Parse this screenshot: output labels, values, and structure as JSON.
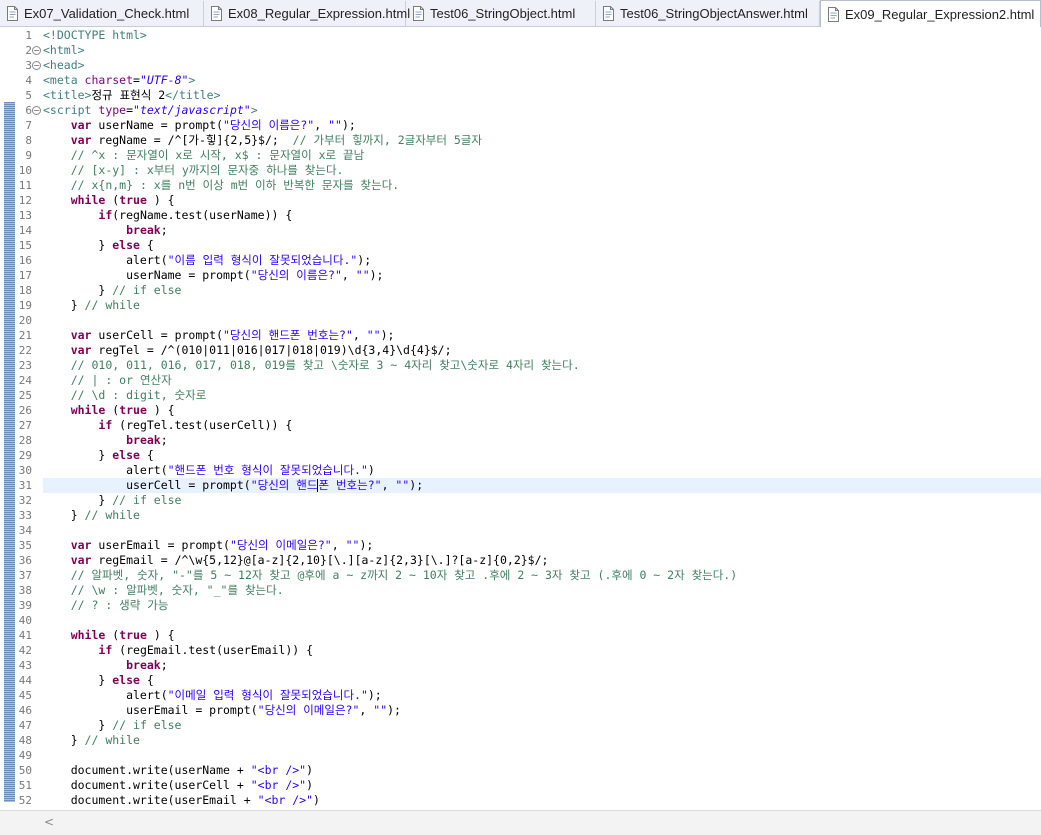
{
  "tabs": [
    {
      "label": "Ex07_Validation_Check.html",
      "active": false
    },
    {
      "label": "Ex08_Regular_Expression.html",
      "active": false
    },
    {
      "label": "Test06_StringObject.html",
      "active": false
    },
    {
      "label": "Test06_StringObjectAnswer.html",
      "active": false
    },
    {
      "label": "Ex09_Regular_Expression2.html",
      "active": true
    }
  ],
  "close_glyph": "✕",
  "current_line": 31,
  "colors": {
    "keyword": "#7f0055",
    "string": "#2a00ff",
    "comment": "#3f7f5f",
    "tag": "#3f7f7f",
    "attribute": "#7f007f",
    "current_line_bg": "#e8f2fe"
  },
  "code_lines": [
    {
      "n": "1",
      "fold": "",
      "segs": [
        [
          "tag",
          "<!DOCTYPE html>"
        ]
      ]
    },
    {
      "n": "2",
      "fold": "⊖",
      "segs": [
        [
          "tag",
          "<html>"
        ]
      ]
    },
    {
      "n": "3",
      "fold": "⊖",
      "segs": [
        [
          "tag",
          "<head>"
        ]
      ]
    },
    {
      "n": "4",
      "fold": "",
      "segs": [
        [
          "tag",
          "<meta "
        ],
        [
          "attr",
          "charset"
        ],
        [
          "",
          "="
        ],
        [
          "aval",
          "\"UTF-8\""
        ],
        [
          "tag",
          ">"
        ]
      ]
    },
    {
      "n": "5",
      "fold": "",
      "segs": [
        [
          "tag",
          "<title>"
        ],
        [
          "",
          "정규 표현식 2"
        ],
        [
          "tag",
          "</title>"
        ]
      ]
    },
    {
      "n": "6",
      "fold": "⊖",
      "segs": [
        [
          "tag",
          "<script "
        ],
        [
          "attr",
          "type"
        ],
        [
          "",
          "="
        ],
        [
          "aval",
          "\"text/javascript\""
        ],
        [
          "tag",
          ">"
        ]
      ]
    },
    {
      "n": "7",
      "fold": "",
      "segs": [
        [
          "",
          "    "
        ],
        [
          "kw",
          "var"
        ],
        [
          "",
          " userName = prompt("
        ],
        [
          "str",
          "\"당신의 이름은?\""
        ],
        [
          "",
          ", "
        ],
        [
          "str",
          "\"\""
        ],
        [
          "",
          ");"
        ]
      ]
    },
    {
      "n": "8",
      "fold": "",
      "segs": [
        [
          "",
          "    "
        ],
        [
          "kw",
          "var"
        ],
        [
          "",
          " regName = /^[가-힣]{2,5}$/;  "
        ],
        [
          "cmt",
          "// 가부터 힣까지, 2글자부터 5글자"
        ]
      ]
    },
    {
      "n": "9",
      "fold": "",
      "segs": [
        [
          "",
          "    "
        ],
        [
          "cmt",
          "// ^x : 문자열이 x로 시작, x$ : 문자열이 x로 끝남"
        ]
      ]
    },
    {
      "n": "10",
      "fold": "",
      "segs": [
        [
          "",
          "    "
        ],
        [
          "cmt",
          "// [x-y] : x부터 y까지의 문자중 하나를 찾는다."
        ]
      ]
    },
    {
      "n": "11",
      "fold": "",
      "segs": [
        [
          "",
          "    "
        ],
        [
          "cmt",
          "// x{n,m} : x를 n번 이상 m번 이하 반복한 문자를 찾는다."
        ]
      ]
    },
    {
      "n": "12",
      "fold": "",
      "segs": [
        [
          "",
          "    "
        ],
        [
          "kw",
          "while"
        ],
        [
          "",
          " ("
        ],
        [
          "kw",
          "true"
        ],
        [
          "",
          " ) {"
        ]
      ]
    },
    {
      "n": "13",
      "fold": "",
      "segs": [
        [
          "",
          "        "
        ],
        [
          "kw",
          "if"
        ],
        [
          "",
          "(regName.test(userName)) {"
        ]
      ]
    },
    {
      "n": "14",
      "fold": "",
      "segs": [
        [
          "",
          "            "
        ],
        [
          "kw",
          "break"
        ],
        [
          "",
          ";"
        ]
      ]
    },
    {
      "n": "15",
      "fold": "",
      "segs": [
        [
          "",
          "        } "
        ],
        [
          "kw",
          "else"
        ],
        [
          "",
          " {"
        ]
      ]
    },
    {
      "n": "16",
      "fold": "",
      "segs": [
        [
          "",
          "            alert("
        ],
        [
          "str",
          "\"이름 입력 형식이 잘못되었습니다.\""
        ],
        [
          "",
          ");"
        ]
      ]
    },
    {
      "n": "17",
      "fold": "",
      "segs": [
        [
          "",
          "            userName = prompt("
        ],
        [
          "str",
          "\"당신의 이름은?\""
        ],
        [
          "",
          ", "
        ],
        [
          "str",
          "\"\""
        ],
        [
          "",
          ");"
        ]
      ]
    },
    {
      "n": "18",
      "fold": "",
      "segs": [
        [
          "",
          "        } "
        ],
        [
          "cmt",
          "// if else"
        ]
      ]
    },
    {
      "n": "19",
      "fold": "",
      "segs": [
        [
          "",
          "    } "
        ],
        [
          "cmt",
          "// while"
        ]
      ]
    },
    {
      "n": "20",
      "fold": "",
      "segs": []
    },
    {
      "n": "21",
      "fold": "",
      "segs": [
        [
          "",
          "    "
        ],
        [
          "kw",
          "var"
        ],
        [
          "",
          " userCell = prompt("
        ],
        [
          "str",
          "\"당신의 핸드폰 번호는?\""
        ],
        [
          "",
          ", "
        ],
        [
          "str",
          "\"\""
        ],
        [
          "",
          ");"
        ]
      ]
    },
    {
      "n": "22",
      "fold": "",
      "segs": [
        [
          "",
          "    "
        ],
        [
          "kw",
          "var"
        ],
        [
          "",
          " regTel = /^(010|011|016|017|018|019)\\d{3,4}\\d{4}$/;"
        ]
      ]
    },
    {
      "n": "23",
      "fold": "",
      "segs": [
        [
          "",
          "    "
        ],
        [
          "cmt",
          "// 010, 011, 016, 017, 018, 019를 찾고 \\숫자로 3 ~ 4자리 찾고\\숫자로 4자리 찾는다."
        ]
      ]
    },
    {
      "n": "24",
      "fold": "",
      "segs": [
        [
          "",
          "    "
        ],
        [
          "cmt",
          "// | : or 연산자"
        ]
      ]
    },
    {
      "n": "25",
      "fold": "",
      "segs": [
        [
          "",
          "    "
        ],
        [
          "cmt",
          "// \\d : digit, 숫자로"
        ]
      ]
    },
    {
      "n": "26",
      "fold": "",
      "segs": [
        [
          "",
          "    "
        ],
        [
          "kw",
          "while"
        ],
        [
          "",
          " ("
        ],
        [
          "kw",
          "true"
        ],
        [
          "",
          " ) {"
        ]
      ]
    },
    {
      "n": "27",
      "fold": "",
      "segs": [
        [
          "",
          "        "
        ],
        [
          "kw",
          "if"
        ],
        [
          "",
          " (regTel.test(userCell)) {"
        ]
      ]
    },
    {
      "n": "28",
      "fold": "",
      "segs": [
        [
          "",
          "            "
        ],
        [
          "kw",
          "break"
        ],
        [
          "",
          ";"
        ]
      ]
    },
    {
      "n": "29",
      "fold": "",
      "segs": [
        [
          "",
          "        } "
        ],
        [
          "kw",
          "else"
        ],
        [
          "",
          " {"
        ]
      ]
    },
    {
      "n": "30",
      "fold": "",
      "segs": [
        [
          "",
          "            alert("
        ],
        [
          "str",
          "\"핸드폰 번호 형식이 잘못되었습니다.\""
        ],
        [
          "",
          ")"
        ]
      ]
    },
    {
      "n": "31",
      "fold": "",
      "segs": [
        [
          "",
          "            userCell = prompt("
        ],
        [
          "str",
          "\"당신의 핸드"
        ],
        [
          "caret",
          ""
        ],
        [
          "str",
          "폰 번호는?\""
        ],
        [
          "",
          ", "
        ],
        [
          "str",
          "\"\""
        ],
        [
          "",
          ");"
        ]
      ]
    },
    {
      "n": "32",
      "fold": "",
      "segs": [
        [
          "",
          "        } "
        ],
        [
          "cmt",
          "// if else"
        ]
      ]
    },
    {
      "n": "33",
      "fold": "",
      "segs": [
        [
          "",
          "    } "
        ],
        [
          "cmt",
          "// while"
        ]
      ]
    },
    {
      "n": "34",
      "fold": "",
      "segs": []
    },
    {
      "n": "35",
      "fold": "",
      "segs": [
        [
          "",
          "    "
        ],
        [
          "kw",
          "var"
        ],
        [
          "",
          " userEmail = prompt("
        ],
        [
          "str",
          "\"당신의 이메일은?\""
        ],
        [
          "",
          ", "
        ],
        [
          "str",
          "\"\""
        ],
        [
          "",
          ");"
        ]
      ]
    },
    {
      "n": "36",
      "fold": "",
      "segs": [
        [
          "",
          "    "
        ],
        [
          "kw",
          "var"
        ],
        [
          "",
          " regEmail = /^\\w{5,12}@[a-z]{2,10}[\\.][a-z]{2,3}[\\.]?[a-z]{0,2}$/;"
        ]
      ]
    },
    {
      "n": "37",
      "fold": "",
      "segs": [
        [
          "",
          "    "
        ],
        [
          "cmt",
          "// 알파벳, 숫자, \"-\"를 5 ~ 12자 찾고 @후에 a ~ z까지 2 ~ 10자 찾고 .후에 2 ~ 3자 찾고 (.후에 0 ~ 2자 찾는다.)"
        ]
      ]
    },
    {
      "n": "38",
      "fold": "",
      "segs": [
        [
          "",
          "    "
        ],
        [
          "cmt",
          "// \\w : 알파벳, 숫자, \"_\"를 찾는다."
        ]
      ]
    },
    {
      "n": "39",
      "fold": "",
      "segs": [
        [
          "",
          "    "
        ],
        [
          "cmt",
          "// ? : 생략 가능"
        ]
      ]
    },
    {
      "n": "40",
      "fold": "",
      "segs": []
    },
    {
      "n": "41",
      "fold": "",
      "segs": [
        [
          "",
          "    "
        ],
        [
          "kw",
          "while"
        ],
        [
          "",
          " ("
        ],
        [
          "kw",
          "true"
        ],
        [
          "",
          " ) {"
        ]
      ]
    },
    {
      "n": "42",
      "fold": "",
      "segs": [
        [
          "",
          "        "
        ],
        [
          "kw",
          "if"
        ],
        [
          "",
          " (regEmail.test(userEmail)) {"
        ]
      ]
    },
    {
      "n": "43",
      "fold": "",
      "segs": [
        [
          "",
          "            "
        ],
        [
          "kw",
          "break"
        ],
        [
          "",
          ";"
        ]
      ]
    },
    {
      "n": "44",
      "fold": "",
      "segs": [
        [
          "",
          "        } "
        ],
        [
          "kw",
          "else"
        ],
        [
          "",
          " {"
        ]
      ]
    },
    {
      "n": "45",
      "fold": "",
      "segs": [
        [
          "",
          "            alert("
        ],
        [
          "str",
          "\"이메일 입력 형식이 잘못되었습니다.\""
        ],
        [
          "",
          ");"
        ]
      ]
    },
    {
      "n": "46",
      "fold": "",
      "segs": [
        [
          "",
          "            userEmail = prompt("
        ],
        [
          "str",
          "\"당신의 이메일은?\""
        ],
        [
          "",
          ", "
        ],
        [
          "str",
          "\"\""
        ],
        [
          "",
          ");"
        ]
      ]
    },
    {
      "n": "47",
      "fold": "",
      "segs": [
        [
          "",
          "        } "
        ],
        [
          "cmt",
          "// if else"
        ]
      ]
    },
    {
      "n": "48",
      "fold": "",
      "segs": [
        [
          "",
          "    } "
        ],
        [
          "cmt",
          "// while"
        ]
      ]
    },
    {
      "n": "49",
      "fold": "",
      "segs": []
    },
    {
      "n": "50",
      "fold": "",
      "segs": [
        [
          "",
          "    document.write(userName + "
        ],
        [
          "str",
          "\"<br />\""
        ],
        [
          "",
          ")"
        ]
      ]
    },
    {
      "n": "51",
      "fold": "",
      "segs": [
        [
          "",
          "    document.write(userCell + "
        ],
        [
          "str",
          "\"<br />\""
        ],
        [
          "",
          ")"
        ]
      ]
    },
    {
      "n": "52",
      "fold": "",
      "segs": [
        [
          "",
          "    document.write(userEmail + "
        ],
        [
          "str",
          "\"<br />\""
        ],
        [
          "",
          ")"
        ]
      ]
    }
  ],
  "scrollbar": {
    "left_arrow": "<"
  }
}
